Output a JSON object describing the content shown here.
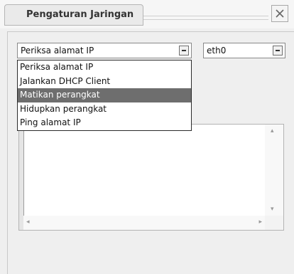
{
  "window": {
    "title": "Pengaturan Jaringan",
    "close_icon": "close-icon"
  },
  "action_combo": {
    "value": "Periksa alamat IP"
  },
  "interface_combo": {
    "value": "eth0"
  },
  "dropdown": {
    "items": [
      {
        "label": "Periksa alamat IP",
        "selected": false
      },
      {
        "label": "Jalankan DHCP Client",
        "selected": false
      },
      {
        "label": "Matikan perangkat",
        "selected": true
      },
      {
        "label": "Hidupkan perangkat",
        "selected": false
      },
      {
        "label": "Ping alamat IP",
        "selected": false
      }
    ]
  },
  "output": {
    "text": ""
  },
  "colors": {
    "selection": "#6e6e6e",
    "background": "#efefef"
  }
}
